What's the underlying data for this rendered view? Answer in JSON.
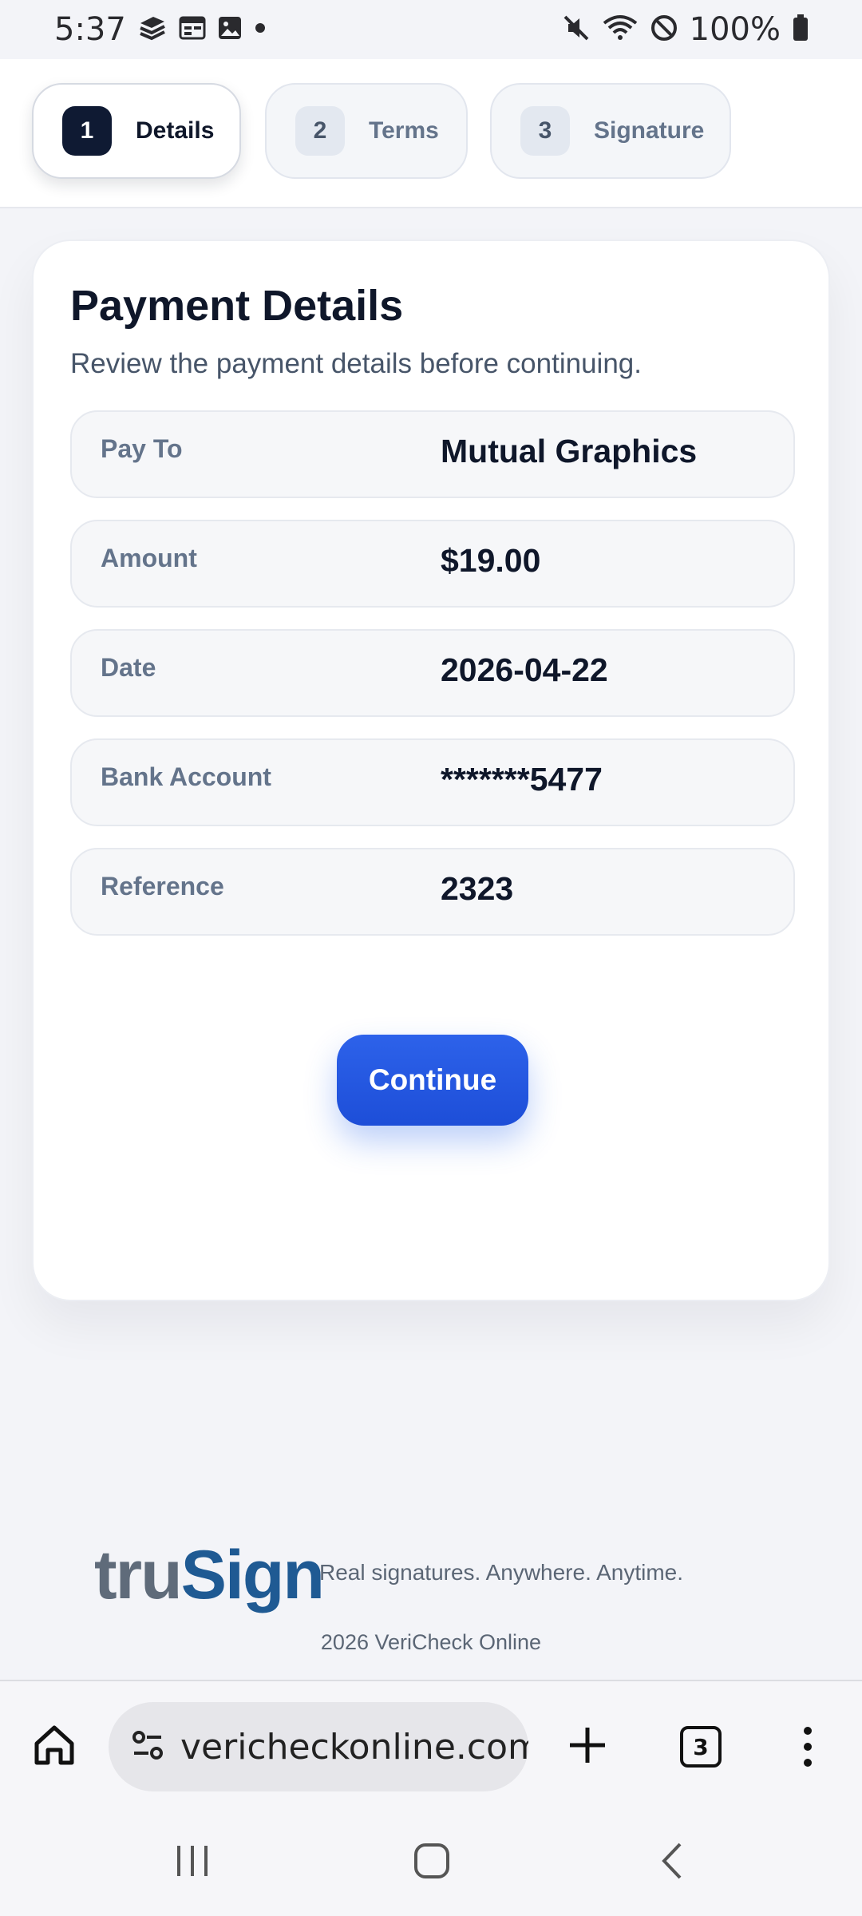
{
  "status_bar": {
    "time": "5:37",
    "battery": "100%",
    "icons": [
      "stack-icon",
      "calendar-icon",
      "image-icon",
      "dot-icon",
      "mute-icon",
      "wifi-icon",
      "no-disturb-icon",
      "battery-icon"
    ]
  },
  "stepper": {
    "steps": [
      {
        "number": "1",
        "label": "Details",
        "active": true
      },
      {
        "number": "2",
        "label": "Terms",
        "active": false
      },
      {
        "number": "3",
        "label": "Signature",
        "active": false
      }
    ]
  },
  "card": {
    "title": "Payment Details",
    "subtitle": "Review the payment details before continuing.",
    "rows": [
      {
        "label": "Pay To",
        "value": "Mutual Graphics"
      },
      {
        "label": "Amount",
        "value": "$19.00"
      },
      {
        "label": "Date",
        "value": "2026-04-22"
      },
      {
        "label": "Bank Account",
        "value": "*******5477"
      },
      {
        "label": "Reference",
        "value": "2323"
      }
    ],
    "continue_label": "Continue"
  },
  "footer": {
    "logo_tru": "tru",
    "logo_sign": "Sign",
    "tagline": "Real signatures. Anywhere. Anytime.",
    "copyright": "2026 VeriCheck Online"
  },
  "browser": {
    "url": "vericheckonline.com",
    "tab_count": "3"
  },
  "colors": {
    "accent": "#1d4ed8",
    "dark": "#0f1a33",
    "logo_gray": "#5f6b7a",
    "logo_blue": "#1f5a93"
  }
}
